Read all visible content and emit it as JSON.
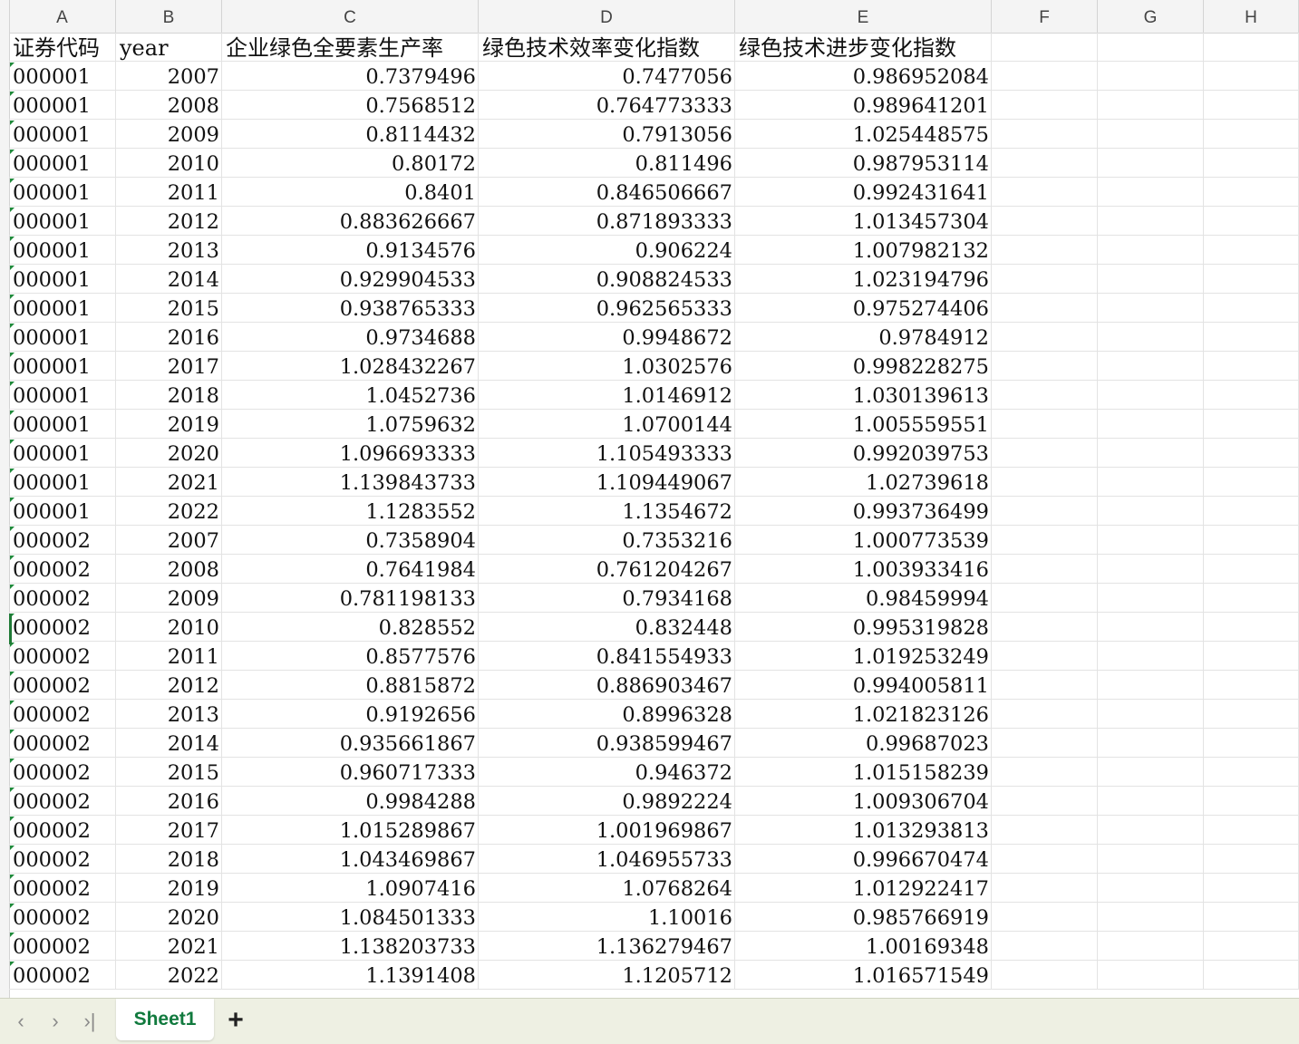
{
  "columns": [
    "A",
    "B",
    "C",
    "D",
    "E",
    "F",
    "G",
    "H"
  ],
  "header_row": [
    "证券代码",
    "year",
    "企业绿色全要素生产率",
    "绿色技术效率变化指数",
    "绿色技术进步变化指数"
  ],
  "rows": [
    [
      "000001",
      "2007",
      "0.7379496",
      "0.7477056",
      "0.986952084"
    ],
    [
      "000001",
      "2008",
      "0.7568512",
      "0.764773333",
      "0.989641201"
    ],
    [
      "000001",
      "2009",
      "0.8114432",
      "0.7913056",
      "1.025448575"
    ],
    [
      "000001",
      "2010",
      "0.80172",
      "0.811496",
      "0.987953114"
    ],
    [
      "000001",
      "2011",
      "0.8401",
      "0.846506667",
      "0.992431641"
    ],
    [
      "000001",
      "2012",
      "0.883626667",
      "0.871893333",
      "1.013457304"
    ],
    [
      "000001",
      "2013",
      "0.9134576",
      "0.906224",
      "1.007982132"
    ],
    [
      "000001",
      "2014",
      "0.929904533",
      "0.908824533",
      "1.023194796"
    ],
    [
      "000001",
      "2015",
      "0.938765333",
      "0.962565333",
      "0.975274406"
    ],
    [
      "000001",
      "2016",
      "0.9734688",
      "0.9948672",
      "0.9784912"
    ],
    [
      "000001",
      "2017",
      "1.028432267",
      "1.0302576",
      "0.998228275"
    ],
    [
      "000001",
      "2018",
      "1.0452736",
      "1.0146912",
      "1.030139613"
    ],
    [
      "000001",
      "2019",
      "1.0759632",
      "1.0700144",
      "1.005559551"
    ],
    [
      "000001",
      "2020",
      "1.096693333",
      "1.105493333",
      "0.992039753"
    ],
    [
      "000001",
      "2021",
      "1.139843733",
      "1.109449067",
      "1.02739618"
    ],
    [
      "000001",
      "2022",
      "1.1283552",
      "1.1354672",
      "0.993736499"
    ],
    [
      "000002",
      "2007",
      "0.7358904",
      "0.7353216",
      "1.000773539"
    ],
    [
      "000002",
      "2008",
      "0.7641984",
      "0.761204267",
      "1.003933416"
    ],
    [
      "000002",
      "2009",
      "0.781198133",
      "0.7934168",
      "0.98459994"
    ],
    [
      "000002",
      "2010",
      "0.828552",
      "0.832448",
      "0.995319828"
    ],
    [
      "000002",
      "2011",
      "0.8577576",
      "0.841554933",
      "1.019253249"
    ],
    [
      "000002",
      "2012",
      "0.8815872",
      "0.886903467",
      "0.994005811"
    ],
    [
      "000002",
      "2013",
      "0.9192656",
      "0.8996328",
      "1.021823126"
    ],
    [
      "000002",
      "2014",
      "0.935661867",
      "0.938599467",
      "0.99687023"
    ],
    [
      "000002",
      "2015",
      "0.960717333",
      "0.946372",
      "1.015158239"
    ],
    [
      "000002",
      "2016",
      "0.9984288",
      "0.9892224",
      "1.009306704"
    ],
    [
      "000002",
      "2017",
      "1.015289867",
      "1.001969867",
      "1.013293813"
    ],
    [
      "000002",
      "2018",
      "1.043469867",
      "1.046955733",
      "0.996670474"
    ],
    [
      "000002",
      "2019",
      "1.0907416",
      "1.0768264",
      "1.012922417"
    ],
    [
      "000002",
      "2020",
      "1.084501333",
      "1.10016",
      "0.985766919"
    ],
    [
      "000002",
      "2021",
      "1.138203733",
      "1.136279467",
      "1.00169348"
    ],
    [
      "000002",
      "2022",
      "1.1391408",
      "1.1205712",
      "1.016571549"
    ]
  ],
  "tabs": {
    "nav_prev_icon": "chevron-left-icon",
    "nav_next_icon": "chevron-right-icon",
    "nav_last_icon": "chevron-last-icon",
    "active_sheet": "Sheet1",
    "add_label": "+"
  },
  "colors": {
    "accent_green": "#117a3e",
    "tabbar_bg": "#eef0e3"
  }
}
